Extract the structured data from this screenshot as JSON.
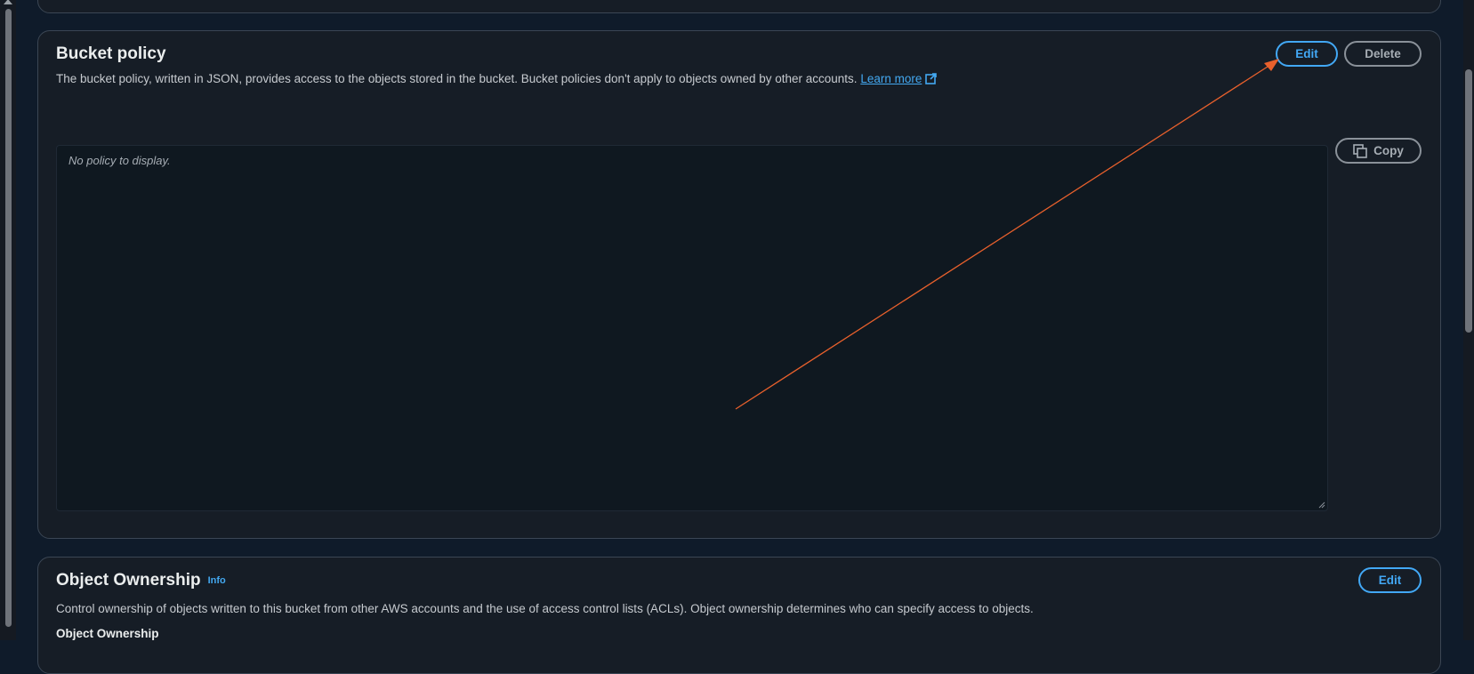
{
  "bucket_policy": {
    "title": "Bucket policy",
    "description": "The bucket policy, written in JSON, provides access to the objects stored in the bucket. Bucket policies don't apply to objects owned by other accounts.",
    "learn_more": "Learn more",
    "edit_label": "Edit",
    "delete_label": "Delete",
    "copy_label": "Copy",
    "empty_text": "No policy to display."
  },
  "object_ownership": {
    "title": "Object Ownership",
    "info_label": "Info",
    "description": "Control ownership of objects written to this bucket from other AWS accounts and the use of access control lists (ACLs). Object ownership determines who can specify access to objects.",
    "edit_label": "Edit",
    "subheading": "Object Ownership"
  },
  "colors": {
    "accent": "#42a8f5",
    "background": "#0f1b2a",
    "panel": "#161d26",
    "annotation_arrow": "#e8602c"
  },
  "icons": {
    "external": "external-link-icon",
    "copy": "copy-icon",
    "resize": "resize-handle-icon"
  }
}
